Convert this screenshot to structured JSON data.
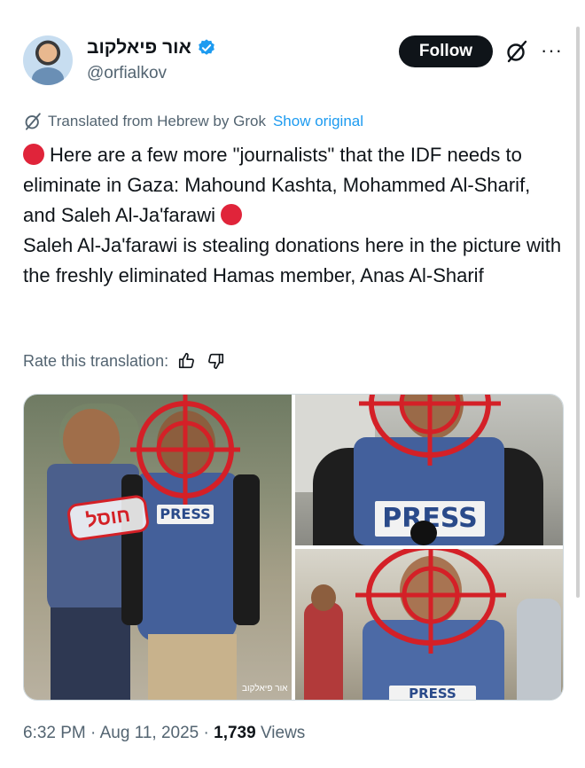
{
  "author": {
    "display_name": "אור פיאלקוב",
    "handle": "@orfialkov",
    "verified": true,
    "avatar_icon": "avatar-photo"
  },
  "actions": {
    "follow_label": "Follow",
    "grok_icon": "grok-icon",
    "more_icon": "more-icon"
  },
  "translation": {
    "note": "Translated from Hebrew by Grok",
    "show_original": "Show original",
    "rate_label": "Rate this translation:"
  },
  "tweet": {
    "text_main": "Here are a few more \"journalists\" that the IDF needs to eliminate in Gaza: Mahound Kashta, Mohammed Al-Sharif, and Saleh Al-Ja'farawi",
    "text_second": "Saleh Al-Ja'farawi is stealing donations here in the picture with the freshly eliminated Hamas member, Anas Al-Sharif"
  },
  "media": {
    "stamp_text": "חוסל",
    "press_label": "PRESS",
    "watermark": "אור פיאלקוב",
    "crosshair_color": "#d42027"
  },
  "meta": {
    "time": "6:32 PM",
    "separator": "·",
    "date": "Aug 11, 2025",
    "views_count": "1,739",
    "views_label": "Views"
  },
  "colors": {
    "accent": "#1d9bf0",
    "text": "#0f1419",
    "secondary": "#536471",
    "red_dot": "#e0243a"
  }
}
